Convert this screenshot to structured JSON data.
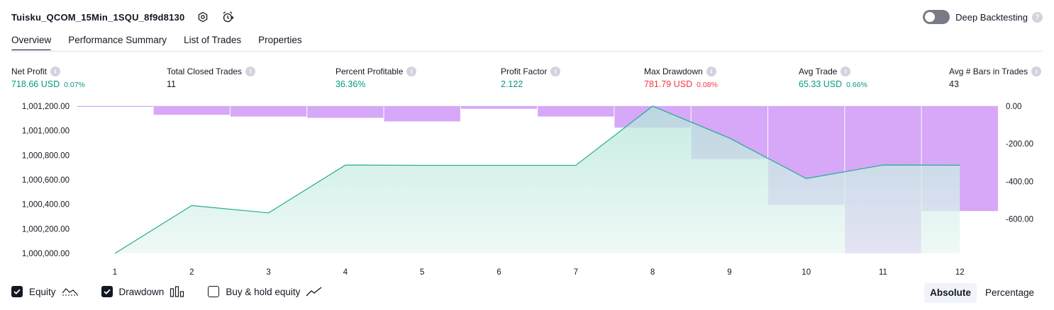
{
  "header": {
    "strategy_name": "Tuisku_QCOM_15Min_1SQU_8f9d8130",
    "settings_icon": "gear-icon",
    "alert_icon": "alarm-clock-plus-icon",
    "deep_backtesting_label": "Deep Backtesting",
    "deep_backtesting_on": false,
    "help": "?"
  },
  "tabs": [
    {
      "label": "Overview",
      "active": true
    },
    {
      "label": "Performance Summary",
      "active": false
    },
    {
      "label": "List of Trades",
      "active": false
    },
    {
      "label": "Properties",
      "active": false
    }
  ],
  "metrics": [
    {
      "label": "Net Profit",
      "value": "718.66 USD",
      "percent": "0.07%",
      "color": "#089981"
    },
    {
      "label": "Total Closed Trades",
      "value": "11",
      "percent": "",
      "color": "#131722"
    },
    {
      "label": "Percent Profitable",
      "value": "36.36%",
      "percent": "",
      "color": "#089981"
    },
    {
      "label": "Profit Factor",
      "value": "2.122",
      "percent": "",
      "color": "#089981"
    },
    {
      "label": "Max Drawdown",
      "value": "781.79 USD",
      "percent": "0.08%",
      "color": "#f23645"
    },
    {
      "label": "Avg Trade",
      "value": "65.33 USD",
      "percent": "0.66%",
      "color": "#089981"
    },
    {
      "label": "Avg # Bars in Trades",
      "value": "43",
      "percent": "",
      "color": "#131722"
    }
  ],
  "chart_data": {
    "type": "area",
    "x": [
      1,
      2,
      3,
      4,
      5,
      6,
      7,
      8,
      9,
      10,
      11,
      12
    ],
    "series": [
      {
        "values": [
          1000000.0,
          1000390.0,
          1000330.0,
          1000720.0,
          1000718.0,
          1000718.0,
          1000718.0,
          1001200.0,
          1000940.0,
          1000610.0,
          1000720.0,
          1000718.66
        ]
      },
      {
        "values": [
          -2.0,
          -46.0,
          -55.0,
          -62.0,
          -81.0,
          -14.0,
          -55.0,
          -114.0,
          -281.0,
          -524.0,
          -781.79,
          -557.0
        ]
      }
    ],
    "left_axis": {
      "ticks": [
        "1,001,200.00",
        "1,001,000.00",
        "1,000,800.00",
        "1,000,600.00",
        "1,000,400.00",
        "1,000,200.00",
        "1,000,000.00"
      ],
      "min": 1000000,
      "max": 1001200
    },
    "right_axis": {
      "ticks": [
        "0.00",
        "-200.00",
        "-400.00",
        "-600.00"
      ],
      "min": -781.79,
      "max": 0
    },
    "x_ticks": [
      "1",
      "2",
      "3",
      "4",
      "5",
      "6",
      "7",
      "8",
      "9",
      "10",
      "11",
      "12"
    ],
    "colors": {
      "equity_line": "#22ab94",
      "equity_fill_top": "#b3e6d9",
      "equity_fill_bottom": "#eaf7f3",
      "drawdown": "#d6a8f7"
    }
  },
  "legend": [
    {
      "label": "Equity",
      "checked": true,
      "icon": "equity-line-icon"
    },
    {
      "label": "Drawdown",
      "checked": true,
      "icon": "drawdown-bars-icon"
    },
    {
      "label": "Buy & hold equity",
      "checked": false,
      "icon": "buy-hold-line-icon"
    }
  ],
  "scale": {
    "absolute_label": "Absolute",
    "percentage_label": "Percentage",
    "selected": "Absolute"
  }
}
